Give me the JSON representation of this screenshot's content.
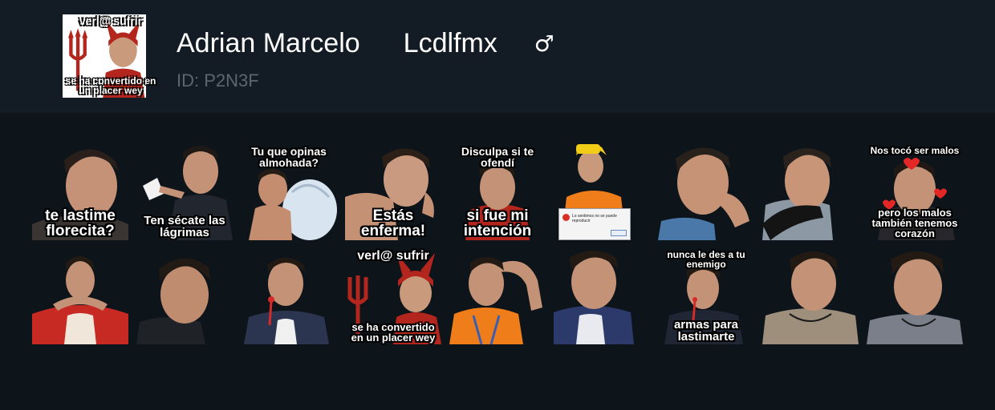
{
  "header": {
    "name": "Adrian Marcelo",
    "handle": "Lcdlfmx",
    "gender_symbol": "♂",
    "id_text": "ID: P2N3F",
    "icon_caption_top": "verl@ sufrir",
    "icon_caption_bottom": "se ha convertido en un placer wey"
  },
  "stickers": [
    {
      "caption_top": "",
      "caption_bottom": "te lastime florecita?"
    },
    {
      "caption_top": "",
      "caption_bottom": "Ten sécate las lágrimas"
    },
    {
      "caption_top": "Tu que opinas almohada?",
      "caption_bottom": ""
    },
    {
      "caption_top": "",
      "caption_bottom": "Estás enferma!"
    },
    {
      "caption_top": "Disculpa si te ofendí",
      "caption_bottom": "si fue mi intención"
    },
    {
      "caption_top": "",
      "caption_bottom": "",
      "dialog_text": "Lo sentimos no se puede reproducir"
    },
    {
      "caption_top": "",
      "caption_bottom": ""
    },
    {
      "caption_top": "",
      "caption_bottom": ""
    },
    {
      "caption_top": "Nos tocó ser malos",
      "caption_bottom": "pero los malos también tenemos corazón"
    },
    {
      "caption_top": "",
      "caption_bottom": ""
    },
    {
      "caption_top": "",
      "caption_bottom": ""
    },
    {
      "caption_top": "",
      "caption_bottom": ""
    },
    {
      "caption_top": "verl@ sufrir",
      "caption_bottom": "se ha convertido en un placer wey"
    },
    {
      "caption_top": "",
      "caption_bottom": ""
    },
    {
      "caption_top": "",
      "caption_bottom": ""
    },
    {
      "caption_top": "nunca le des a tu enemigo",
      "caption_bottom": "armas para lastimarte"
    },
    {
      "caption_top": "",
      "caption_bottom": ""
    },
    {
      "caption_top": "",
      "caption_bottom": ""
    }
  ],
  "colors": {
    "page_background": "#0d141a",
    "header_background": "#131c24",
    "id_text": "#5c666f",
    "devil_red": "#b3261e"
  }
}
